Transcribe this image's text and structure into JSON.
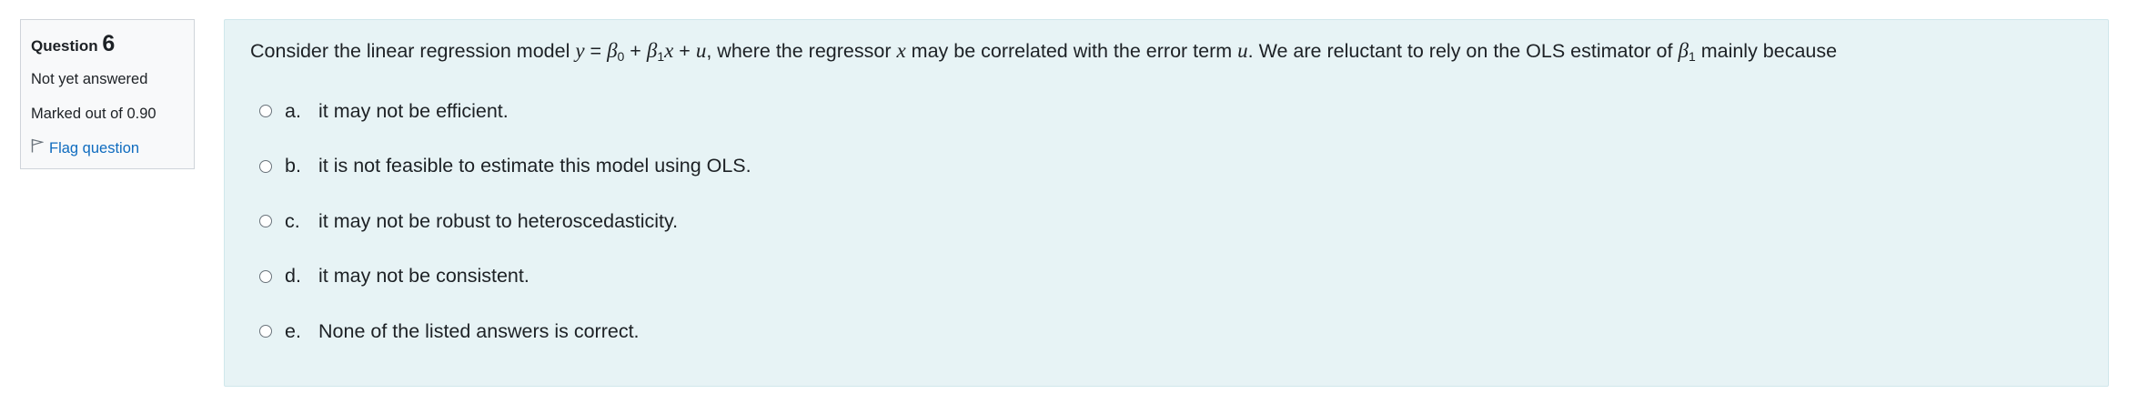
{
  "info": {
    "question_label": "Question",
    "question_number": "6",
    "state": "Not yet answered",
    "grade": "Marked out of 0.90",
    "flag_label": "Flag question"
  },
  "question": {
    "text_1": "Consider the linear regression model ",
    "y": "y",
    "eq": " = ",
    "beta": "β",
    "sub0": "0",
    "plus1": " + ",
    "sub1": "1",
    "x": "x",
    "plus2": " + ",
    "u": "u",
    "text_2": ", where the regressor ",
    "x2": "x",
    "text_3": " may be correlated with the error term ",
    "u2": "u",
    "text_4": ". We are reluctant to rely on the OLS estimator of ",
    "beta2": "β",
    "sub1b": "1",
    "text_5": " mainly because"
  },
  "options": [
    {
      "letter": "a.",
      "text": "it may not be efficient."
    },
    {
      "letter": "b.",
      "text": "it is not feasible to estimate this model using OLS."
    },
    {
      "letter": "c.",
      "text": "it may not be robust to heteroscedasticity."
    },
    {
      "letter": "d.",
      "text": "it may not be consistent."
    },
    {
      "letter": "e.",
      "text": "None of the listed answers is correct."
    }
  ]
}
